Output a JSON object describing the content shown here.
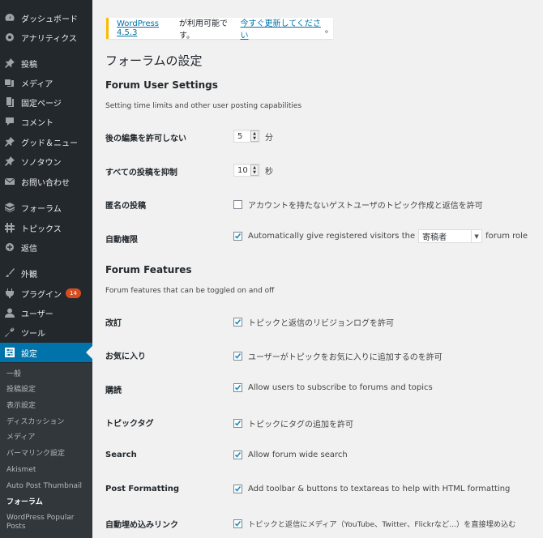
{
  "sidebar": {
    "items": [
      {
        "label": "ダッシュボード",
        "icon": "dashboard-icon"
      },
      {
        "label": "アナリティクス",
        "icon": "analytics-icon"
      },
      {
        "label": "投稿",
        "icon": "pin-icon"
      },
      {
        "label": "メディア",
        "icon": "media-icon"
      },
      {
        "label": "固定ページ",
        "icon": "page-icon"
      },
      {
        "label": "コメント",
        "icon": "comment-icon"
      },
      {
        "label": "グッド＆ニュー",
        "icon": "pin-icon"
      },
      {
        "label": "ソノタウン",
        "icon": "pin-icon"
      },
      {
        "label": "お問い合わせ",
        "icon": "mail-icon"
      },
      {
        "label": "フォーラム",
        "icon": "forum-icon"
      },
      {
        "label": "トピックス",
        "icon": "topics-icon"
      },
      {
        "label": "返信",
        "icon": "replies-icon"
      },
      {
        "label": "外観",
        "icon": "brush-icon"
      },
      {
        "label": "プラグイン",
        "icon": "plugin-icon",
        "badge": "14"
      },
      {
        "label": "ユーザー",
        "icon": "user-icon"
      },
      {
        "label": "ツール",
        "icon": "wrench-icon"
      },
      {
        "label": "設定",
        "icon": "settings-icon"
      }
    ],
    "submenu": [
      "一般",
      "投稿設定",
      "表示設定",
      "ディスカッション",
      "メディア",
      "パーマリンク設定",
      "Akismet",
      "Auto Post Thumbnail",
      "フォーラム",
      "WordPress Popular Posts"
    ]
  },
  "notice": {
    "link_version": "WordPress 4.5.3",
    "text": " が利用可能です。",
    "link_update": "今すぐ更新してください",
    "end": "。"
  },
  "page_title": "フォーラムの設定",
  "user_settings": {
    "title": "Forum User Settings",
    "description": "Setting time limits and other user posting capabilities",
    "edit_lock": {
      "label": "後の編集を許可しない",
      "value": "5",
      "unit": "分"
    },
    "throttle": {
      "label": "すべての投稿を抑制",
      "value": "10",
      "unit": "秒"
    },
    "anonymous": {
      "label": "匿名の投稿",
      "text": "アカウントを持たないゲストユーザのトピック作成と返信を許可"
    },
    "auto_role": {
      "label": "自動権限",
      "text_before": "Automatically give registered visitors the",
      "role": "寄稿者",
      "text_after": "forum role"
    }
  },
  "features": {
    "title": "Forum Features",
    "description": "Forum features that can be toggled on and off",
    "rows": [
      {
        "label": "改訂",
        "text": "トピックと返信のリビジョンログを許可"
      },
      {
        "label": "お気に入り",
        "text": "ユーザーがトピックをお気に入りに追加するのを許可"
      },
      {
        "label": "購読",
        "text": "Allow users to subscribe to forums and topics"
      },
      {
        "label": "トピックタグ",
        "text": "トピックにタグの追加を許可"
      },
      {
        "label": "Search",
        "text": "Allow forum wide search"
      },
      {
        "label": "Post Formatting",
        "text": "Add toolbar & buttons to textareas to help with HTML formatting"
      },
      {
        "label": "自動埋め込みリンク",
        "text": "トピックと返信にメディア（YouTube、Twitter、Flickrなど...）を直接埋め込む"
      }
    ]
  },
  "colors": {
    "sidebar": "#23282d",
    "active": "#0073aa",
    "link": "#0073aa",
    "notice_border": "#ffb900",
    "badge": "#d54e21"
  }
}
